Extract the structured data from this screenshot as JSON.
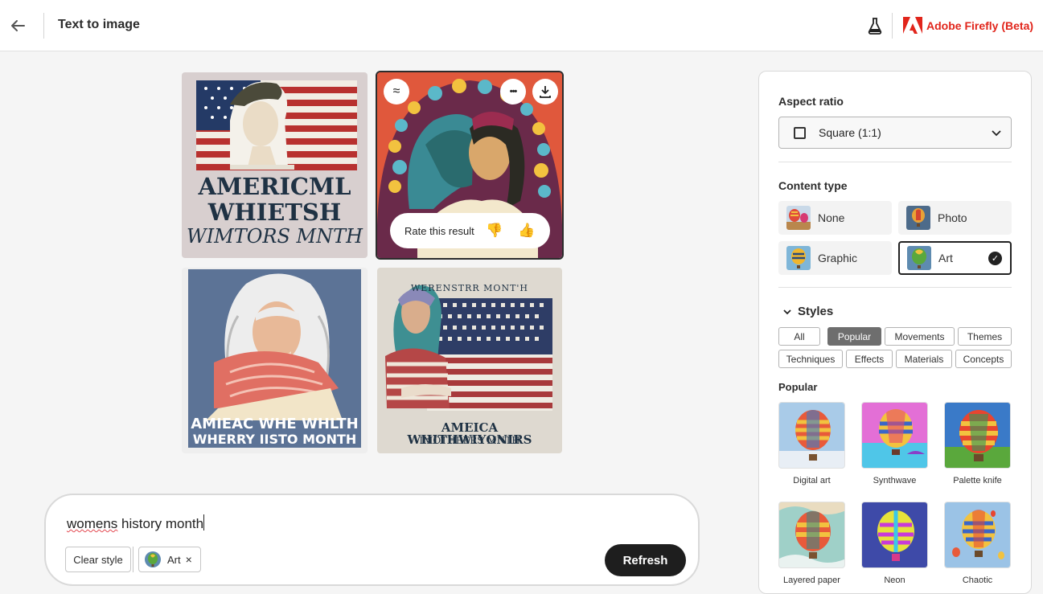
{
  "header": {
    "title": "Text to image",
    "brand": "Adobe Firefly (Beta)",
    "back_icon": "arrow-left-icon",
    "labs_icon": "flask-icon",
    "brand_color": "#e1251b"
  },
  "gallery": {
    "images": [
      {
        "caption_lines": [
          "AMERICML",
          "WHIETSH",
          "WIMTORS MNTH"
        ]
      },
      {
        "caption_lines": []
      },
      {
        "caption_lines": [
          "AMIEAC WHE WHLTH",
          "WHERRY IISTO MONTH"
        ]
      },
      {
        "caption_lines": [
          "WERENSTRR MONT'H",
          "AMEICA WHITHWIYONIRS",
          "IMOTHEERS MNTH"
        ]
      }
    ],
    "selected_tile_rating": {
      "label": "Rate this result",
      "thumbs_down": "👎",
      "thumbs_up": "👍"
    },
    "tile_actions": {
      "similar": "≈",
      "more": "•••"
    }
  },
  "prompt": {
    "text_underlined": "womens",
    "text_rest": " history month",
    "clear_style_label": "Clear style",
    "chip_label": "Art",
    "chip_remove": "×",
    "refresh_label": "Refresh"
  },
  "panel": {
    "aspect_ratio": {
      "heading": "Aspect ratio",
      "value": "Square (1:1)"
    },
    "content_type": {
      "heading": "Content type",
      "options": [
        {
          "label": "None"
        },
        {
          "label": "Photo"
        },
        {
          "label": "Graphic"
        },
        {
          "label": "Art",
          "selected": true
        }
      ]
    },
    "styles": {
      "heading": "Styles",
      "tags": [
        "All",
        "Popular",
        "Movements",
        "Themes",
        "Techniques",
        "Effects",
        "Materials",
        "Concepts"
      ],
      "active_tag": "Popular",
      "section_heading": "Popular",
      "items": [
        "Digital art",
        "Synthwave",
        "Palette knife",
        "Layered paper",
        "Neon",
        "Chaotic"
      ]
    }
  }
}
